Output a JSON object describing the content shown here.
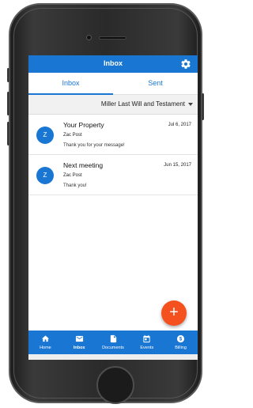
{
  "colors": {
    "primary": "#1976d2",
    "fab": "#f4511e",
    "filter_bg": "#f1f1f1"
  },
  "appbar": {
    "title": "Inbox",
    "settings_icon": "gear-icon"
  },
  "tabs": [
    {
      "label": "Inbox",
      "active": true
    },
    {
      "label": "Sent",
      "active": false
    }
  ],
  "filter": {
    "selected": "Miller Last Will and Testament"
  },
  "messages": [
    {
      "avatar": "Z",
      "subject": "Your Property",
      "from": "Zac Post",
      "snippet": "Thank you for your message!",
      "date": "Jul 6, 2017"
    },
    {
      "avatar": "Z",
      "subject": "Next meeting",
      "from": "Zac Post",
      "snippet": "Thank you!",
      "date": "Jun 15, 2017"
    }
  ],
  "fab": {
    "icon": "plus-icon",
    "label": "+"
  },
  "bottom_nav": [
    {
      "label": "Home",
      "icon": "home-icon",
      "active": false
    },
    {
      "label": "Inbox",
      "icon": "mail-icon",
      "active": true
    },
    {
      "label": "Documents",
      "icon": "document-icon",
      "active": false
    },
    {
      "label": "Events",
      "icon": "calendar-icon",
      "active": false
    },
    {
      "label": "Billing",
      "icon": "dollar-icon",
      "active": false
    }
  ]
}
